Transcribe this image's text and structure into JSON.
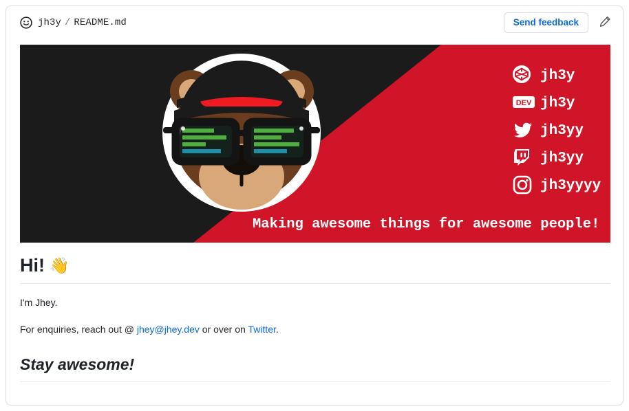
{
  "header": {
    "smiley_icon": "smiley-icon",
    "owner": "jh3y",
    "separator": "/",
    "filename": "README.md",
    "feedback_label": "Send feedback",
    "pencil_icon": "pencil-icon"
  },
  "banner": {
    "dark_color": "#1B1B1B",
    "red_color": "#D01528",
    "tagline": "Making awesome things for awesome people!",
    "social_links": [
      {
        "icon": "codepen-icon",
        "handle": "jh3y"
      },
      {
        "icon": "dev-icon",
        "handle": "jh3y"
      },
      {
        "icon": "twitter-icon",
        "handle": "jh3yy"
      },
      {
        "icon": "twitch-icon",
        "handle": "jh3yy"
      },
      {
        "icon": "instagram-icon",
        "handle": "jh3yyyy"
      }
    ],
    "dev_badge_text": "DEV",
    "avatar": {
      "icon": "bear-avatar-icon",
      "circle_color": "#FFFFFF",
      "fur_color": "#6B3D1F",
      "muzzle_color": "#D9A879",
      "beanie_color": "#1B1B1B",
      "beanie_stripe_color": "#EE1B22"
    }
  },
  "content": {
    "heading_hi": "Hi!",
    "wave_emoji": "👋",
    "intro": "I'm Jhey.",
    "enquiries_prefix": "For enquiries, reach out @ ",
    "email_link": "jhey@jhey.dev",
    "enquiries_middle": " or over on ",
    "twitter_link": "Twitter",
    "enquiries_suffix": ".",
    "heading_stay": "Stay awesome!",
    "link_color": "#0969da"
  }
}
